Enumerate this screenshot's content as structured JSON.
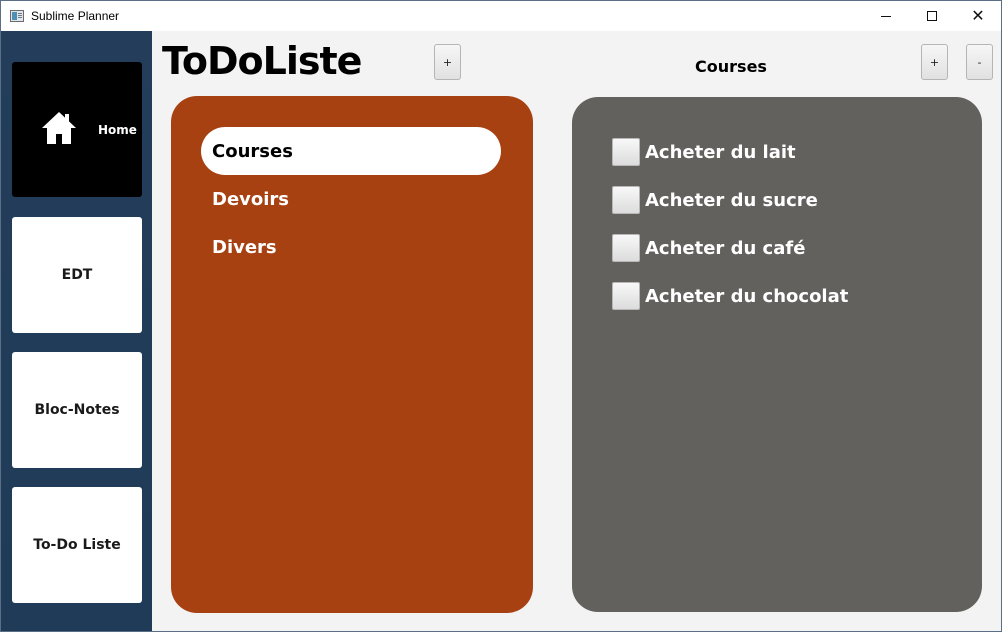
{
  "window": {
    "title": "Sublime Planner"
  },
  "sidebar": {
    "items": [
      {
        "label": "Home"
      },
      {
        "label": "EDT"
      },
      {
        "label": "Bloc-Notes"
      },
      {
        "label": "To-Do Liste"
      }
    ]
  },
  "header": {
    "title": "ToDoListe",
    "add_list_label": "+",
    "current_list": "Courses",
    "add_task_label": "+",
    "remove_task_label": "-"
  },
  "lists": {
    "items": [
      {
        "label": "Courses",
        "selected": true
      },
      {
        "label": "Devoirs",
        "selected": false
      },
      {
        "label": "Divers",
        "selected": false
      }
    ]
  },
  "tasks": {
    "items": [
      {
        "label": "Acheter du lait",
        "checked": false
      },
      {
        "label": "Acheter du sucre",
        "checked": false
      },
      {
        "label": "Acheter du café",
        "checked": false
      },
      {
        "label": "Acheter du chocolat",
        "checked": false
      }
    ]
  },
  "colors": {
    "sidebar": "#1f3b58",
    "lists_panel": "#a84112",
    "tasks_panel": "#62615d",
    "home_tile": "#000000"
  },
  "icons": {
    "app": "app-icon",
    "home": "home-icon",
    "minimize": "minimize-icon",
    "maximize": "maximize-icon",
    "close": "close-icon"
  }
}
